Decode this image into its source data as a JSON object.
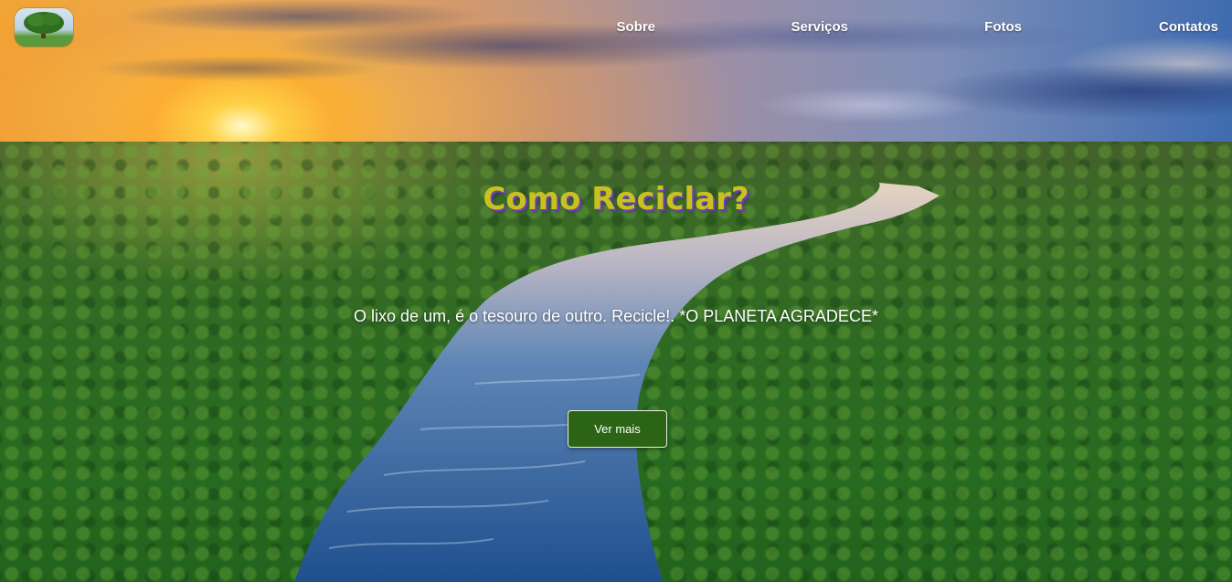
{
  "nav": {
    "logo_icon": "tree-logo-icon",
    "items": [
      {
        "label": "Sobre"
      },
      {
        "label": "Serviços"
      },
      {
        "label": "Fotos"
      },
      {
        "label": "Contatos"
      }
    ]
  },
  "hero": {
    "title": "Como Reciclar?",
    "subtitle": "O lixo de um, é o tesouro de outro. Recicle!. *O PLANETA AGRADECE*",
    "button_label": "Ver mais",
    "colors": {
      "title": "#c9c21e",
      "title_shadow": "#6a3fb8",
      "button": "#2b6414"
    }
  }
}
